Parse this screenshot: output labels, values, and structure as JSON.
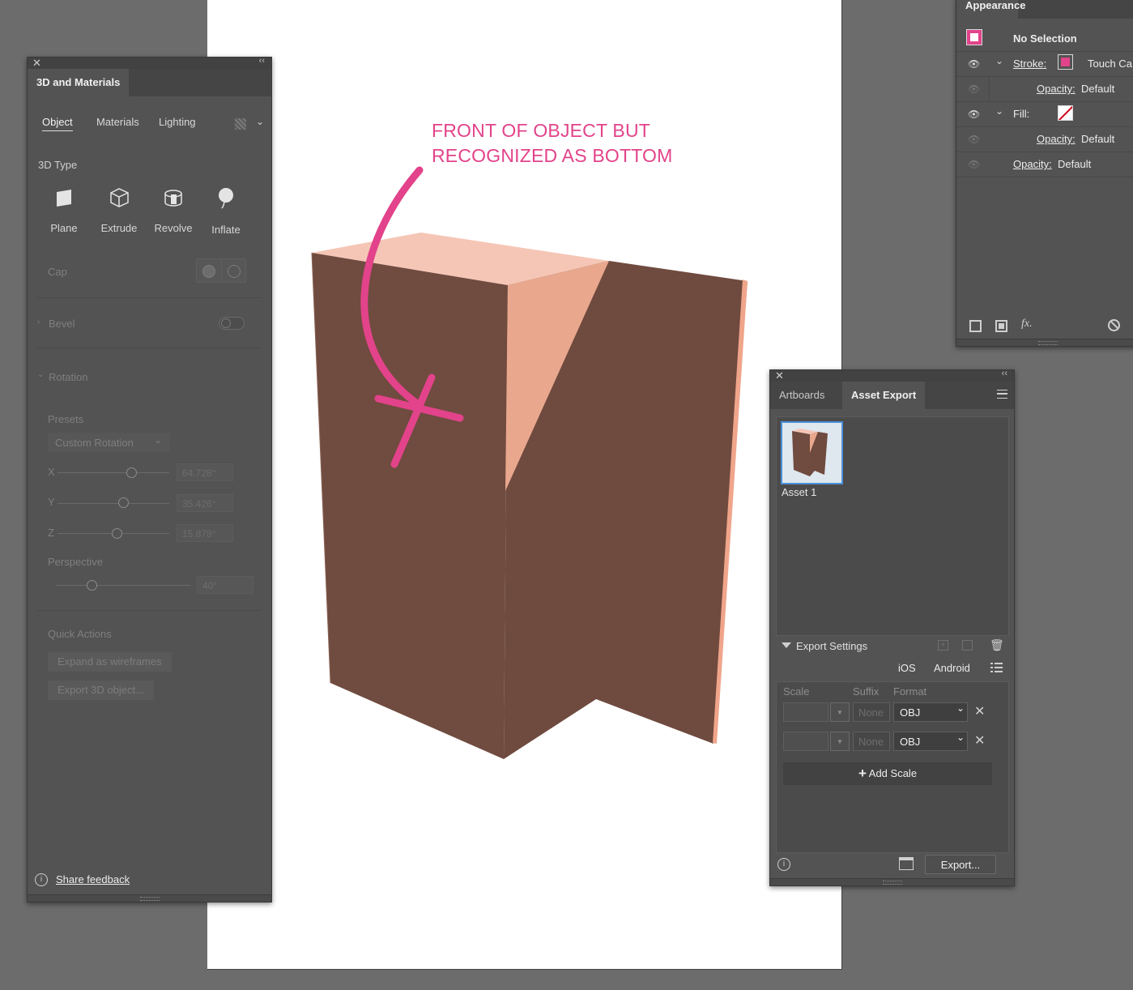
{
  "annotation": {
    "line1": "FRONT OF OBJECT BUT",
    "line2": "RECOGNIZED AS BOTTOM",
    "color": "#e2438a"
  },
  "object_colors": {
    "front": "#704b3f",
    "top": "#f5c6b6",
    "triangle": "#e9a88e",
    "edge": "#f0a58b"
  },
  "panel3d": {
    "title": "3D and Materials",
    "subtabs": [
      "Object",
      "Materials",
      "Lighting"
    ],
    "type_label": "3D Type",
    "types": [
      "Plane",
      "Extrude",
      "Revolve",
      "Inflate"
    ],
    "cap_label": "Cap",
    "bevel_label": "Bevel",
    "rotation_label": "Rotation",
    "presets_label": "Presets",
    "preset_value": "Custom Rotation",
    "x_label": "X",
    "x_value": "64.728°",
    "y_label": "Y",
    "y_value": "35.426°",
    "z_label": "Z",
    "z_value": "15.878°",
    "perspective_label": "Perspective",
    "perspective_value": "40°",
    "quick_actions_label": "Quick Actions",
    "expand_button": "Expand as wireframes",
    "export_button": "Export 3D object...",
    "feedback": "Share feedback"
  },
  "appearance": {
    "title": "Appearance",
    "no_selection": "No Selection",
    "stroke_label": "Stroke:",
    "stroke_value": "Touch Ca",
    "opacity_label": "Opacity:",
    "opacity_value": "Default",
    "fill_label": "Fill:",
    "accent": "#e2438a"
  },
  "asset_export": {
    "tab_artboards": "Artboards",
    "tab_asset_export": "Asset Export",
    "asset_name": "Asset 1",
    "export_settings": "Export Settings",
    "ios": "iOS",
    "android": "Android",
    "col_scale": "Scale",
    "col_suffix": "Suffix",
    "col_format": "Format",
    "rows": [
      {
        "suffix": "None",
        "format": "OBJ"
      },
      {
        "suffix": "None",
        "format": "OBJ"
      }
    ],
    "add_scale": "Add Scale",
    "export_button": "Export..."
  }
}
